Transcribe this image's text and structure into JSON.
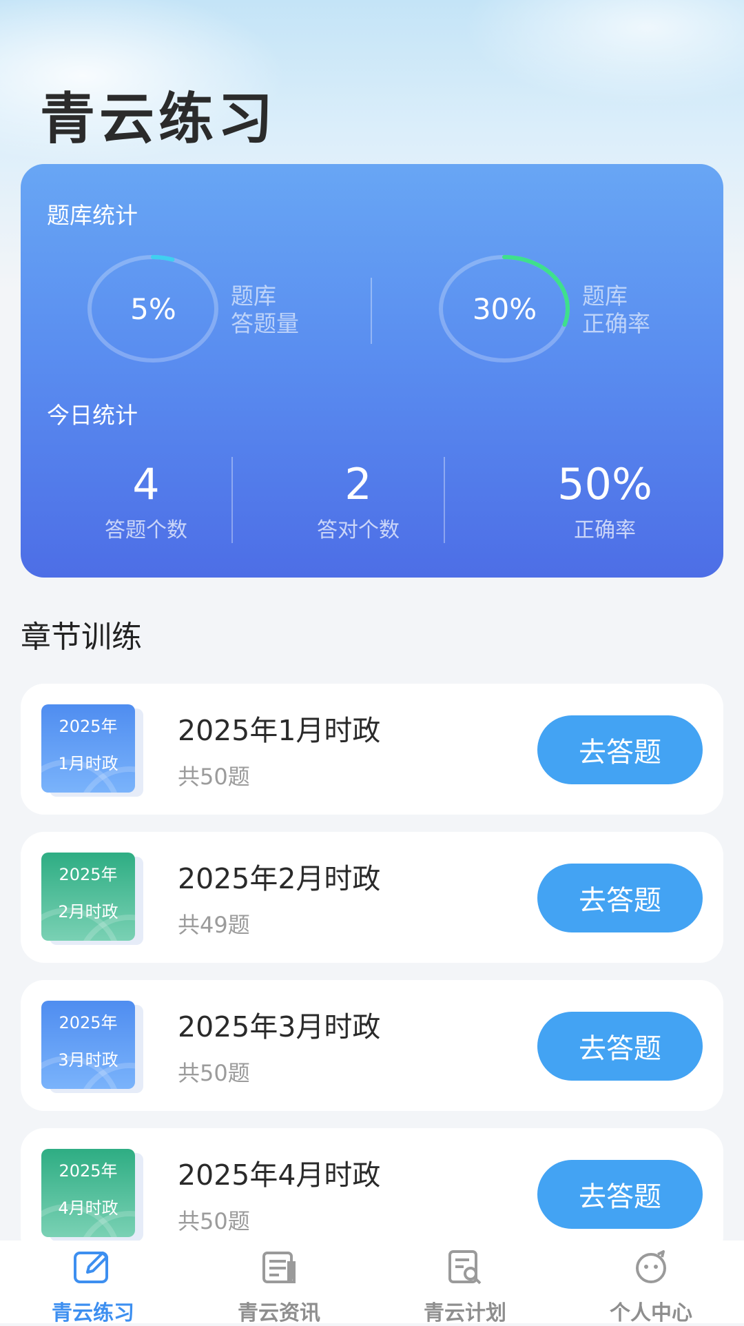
{
  "app": {
    "title": "青云练习"
  },
  "bank_stats": {
    "label": "题库统计",
    "answered": {
      "value": "5%",
      "fraction": 0.05,
      "label_line1": "题库",
      "label_line2": "答题量",
      "arc_color": "#3fd0f0"
    },
    "accuracy": {
      "value": "30%",
      "fraction": 0.3,
      "label_line1": "题库",
      "label_line2": "正确率",
      "arc_color": "#3ee08c"
    }
  },
  "today_stats": {
    "label": "今日统计",
    "items": [
      {
        "value": "4",
        "label": "答题个数"
      },
      {
        "value": "2",
        "label": "答对个数"
      },
      {
        "value": "50%",
        "label": "正确率"
      }
    ]
  },
  "chapters": {
    "heading": "章节训练",
    "items": [
      {
        "thumb_year": "2025年",
        "thumb_month": "1月时政",
        "color": "blue",
        "title": "2025年1月时政",
        "count": "共50题",
        "button": "去答题"
      },
      {
        "thumb_year": "2025年",
        "thumb_month": "2月时政",
        "color": "green",
        "title": "2025年2月时政",
        "count": "共49题",
        "button": "去答题"
      },
      {
        "thumb_year": "2025年",
        "thumb_month": "3月时政",
        "color": "blue",
        "title": "2025年3月时政",
        "count": "共50题",
        "button": "去答题"
      },
      {
        "thumb_year": "2025年",
        "thumb_month": "4月时政",
        "color": "green",
        "title": "2025年4月时政",
        "count": "共50题",
        "button": "去答题"
      }
    ]
  },
  "tabbar": {
    "active_color": "#3d8ff0",
    "items": [
      {
        "label": "青云练习",
        "icon": "edit-icon",
        "active": true
      },
      {
        "label": "青云资讯",
        "icon": "news-icon",
        "active": false
      },
      {
        "label": "青云计划",
        "icon": "plan-search-icon",
        "active": false
      },
      {
        "label": "个人中心",
        "icon": "face-icon",
        "active": false
      }
    ]
  }
}
